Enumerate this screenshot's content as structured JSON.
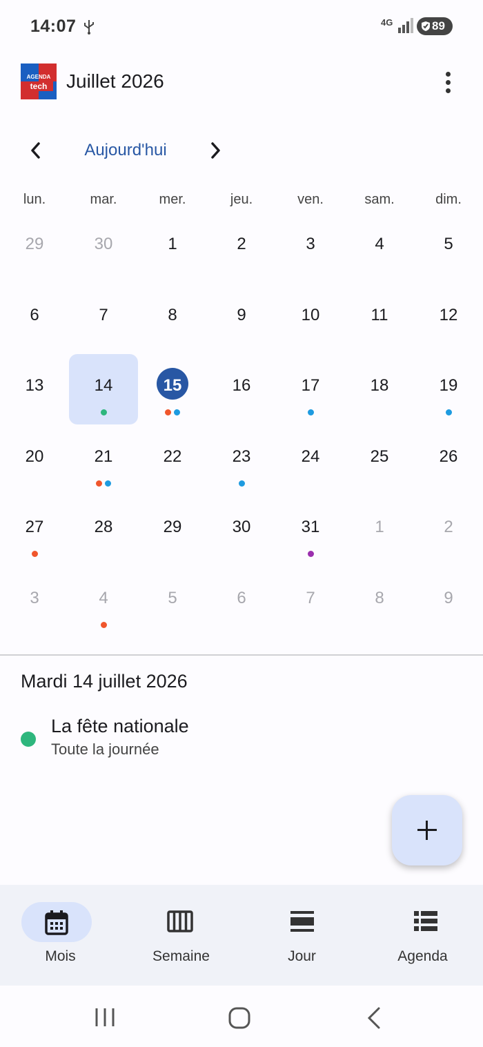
{
  "status_bar": {
    "time": "14:07",
    "network": "4G",
    "battery": "89"
  },
  "header": {
    "logo_line1": "AGENDA",
    "logo_line2": "tech",
    "title": "Juillet 2026"
  },
  "nav": {
    "today_label": "Aujourd'hui"
  },
  "weekdays": [
    "lun.",
    "mar.",
    "mer.",
    "jeu.",
    "ven.",
    "sam.",
    "dim."
  ],
  "weeks": [
    [
      {
        "d": "29",
        "o": true
      },
      {
        "d": "30",
        "o": true
      },
      {
        "d": "1"
      },
      {
        "d": "2"
      },
      {
        "d": "3"
      },
      {
        "d": "4"
      },
      {
        "d": "5"
      }
    ],
    [
      {
        "d": "6"
      },
      {
        "d": "7"
      },
      {
        "d": "8"
      },
      {
        "d": "9"
      },
      {
        "d": "10"
      },
      {
        "d": "11"
      },
      {
        "d": "12"
      }
    ],
    [
      {
        "d": "13"
      },
      {
        "d": "14",
        "sel": true,
        "dots": [
          "#2eb67d"
        ]
      },
      {
        "d": "15",
        "today": true,
        "dots": [
          "#f0562c",
          "#1e9be0"
        ]
      },
      {
        "d": "16"
      },
      {
        "d": "17",
        "dots": [
          "#1e9be0"
        ]
      },
      {
        "d": "18"
      },
      {
        "d": "19",
        "dots": [
          "#1e9be0"
        ]
      }
    ],
    [
      {
        "d": "20"
      },
      {
        "d": "21",
        "dots": [
          "#f0562c",
          "#1e9be0"
        ]
      },
      {
        "d": "22"
      },
      {
        "d": "23",
        "dots": [
          "#1e9be0"
        ]
      },
      {
        "d": "24"
      },
      {
        "d": "25"
      },
      {
        "d": "26"
      }
    ],
    [
      {
        "d": "27",
        "dots": [
          "#f0562c"
        ]
      },
      {
        "d": "28"
      },
      {
        "d": "29"
      },
      {
        "d": "30"
      },
      {
        "d": "31",
        "dots": [
          "#9b2fae"
        ]
      },
      {
        "d": "1",
        "o": true
      },
      {
        "d": "2",
        "o": true
      }
    ],
    [
      {
        "d": "3",
        "o": true
      },
      {
        "d": "4",
        "o": true,
        "dots": [
          "#f0562c"
        ]
      },
      {
        "d": "5",
        "o": true
      },
      {
        "d": "6",
        "o": true
      },
      {
        "d": "7",
        "o": true
      },
      {
        "d": "8",
        "o": true
      },
      {
        "d": "9",
        "o": true
      }
    ]
  ],
  "selected_date": "Mardi 14 juillet 2026",
  "events": [
    {
      "title": "La fête nationale",
      "time": "Toute la journée",
      "color": "#2eb67d"
    }
  ],
  "bottom_nav": [
    {
      "label": "Mois",
      "icon": "calendar-month-icon",
      "active": true
    },
    {
      "label": "Semaine",
      "icon": "view-week-icon",
      "active": false
    },
    {
      "label": "Jour",
      "icon": "view-day-icon",
      "active": false
    },
    {
      "label": "Agenda",
      "icon": "view-agenda-icon",
      "active": false
    }
  ],
  "colors": {
    "accent": "#2857a4",
    "selected_bg": "#d9e3fb"
  }
}
